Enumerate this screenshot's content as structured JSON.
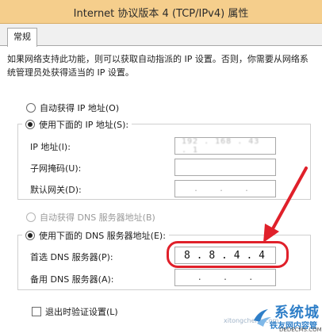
{
  "window": {
    "title": "Internet 协议版本 4 (TCP/IPv4) 属性"
  },
  "tabs": [
    {
      "label": "常规"
    }
  ],
  "description": "如果网络支持此功能，则可以获取自动指派的 IP 设置。否则，你需要从网络系统管理员处获得适当的 IP 设置。",
  "ip_section": {
    "auto_radio": {
      "label": "自动获得 IP 地址(O)",
      "selected": false
    },
    "manual_radio": {
      "label": "使用下面的 IP 地址(S):",
      "selected": true
    },
    "ip_address": {
      "label": "IP 地址(I):",
      "value": "192 . 168 . 43 . 1"
    },
    "subnet_mask": {
      "label": "子网掩码(U):",
      "value": ""
    },
    "gateway": {
      "label": "默认网关(D):",
      "value": ". . ."
    }
  },
  "dns_section": {
    "auto_radio": {
      "label": "自动获得 DNS 服务器地址(B)",
      "selected": false,
      "disabled": true
    },
    "manual_radio": {
      "label": "使用下面的 DNS 服务器地址(E):",
      "selected": true
    },
    "preferred": {
      "label": "首选 DNS 服务器(P):",
      "octets": [
        "8",
        "8",
        "4",
        "4"
      ]
    },
    "alternate": {
      "label": "备用 DNS 服务器(A):",
      "octets": [
        "",
        "",
        "",
        ""
      ]
    }
  },
  "validate_checkbox": {
    "label": "退出时验证设置(L)",
    "checked": false
  },
  "watermark": {
    "brand": "系统城",
    "sub": "铁友网内容管理系统",
    "url": "DEDECMS.COM",
    "left_url": "xitongcheng.com"
  },
  "colors": {
    "titlebar": "#f5ce8c",
    "highlight": "#e0202a",
    "watermark": "#2f7fc8"
  }
}
